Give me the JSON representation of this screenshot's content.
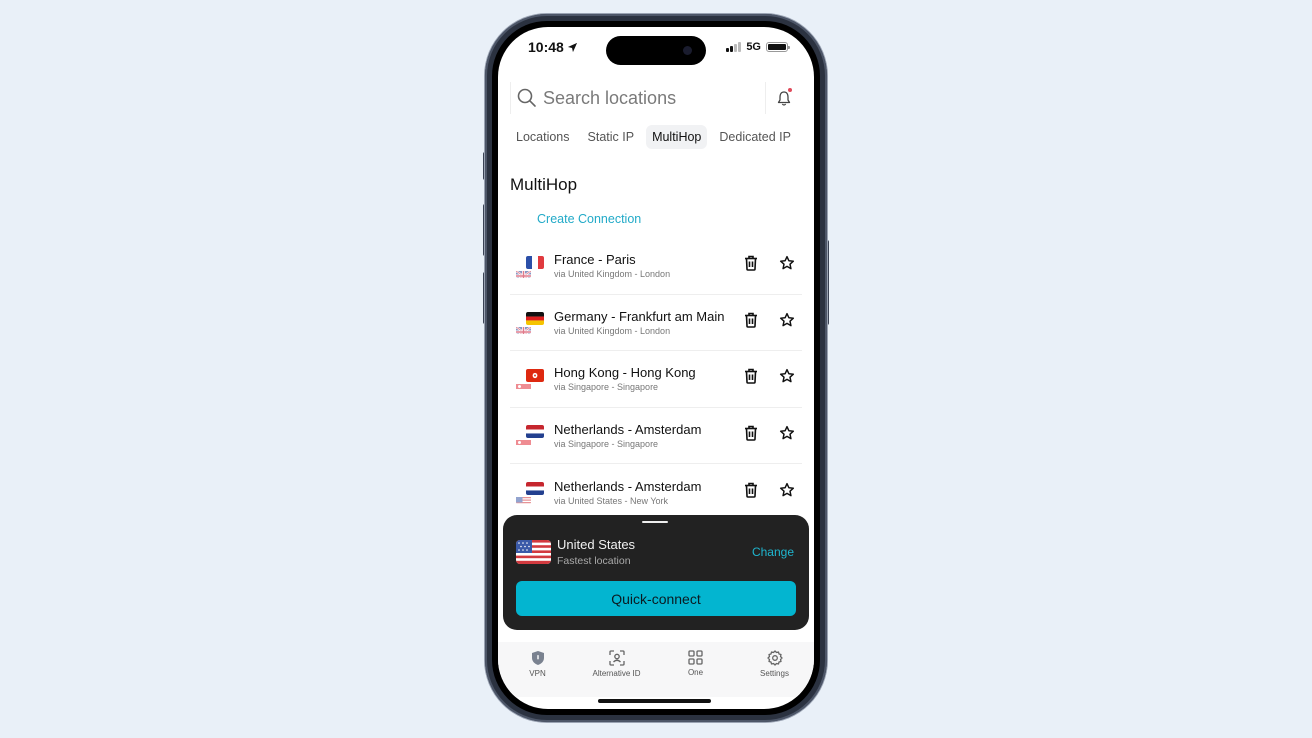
{
  "status_bar": {
    "time": "10:48",
    "network": "5G"
  },
  "search": {
    "placeholder": "Search locations",
    "value": ""
  },
  "tabs": [
    {
      "label": "Locations",
      "active": false
    },
    {
      "label": "Static IP",
      "active": false
    },
    {
      "label": "MultiHop",
      "active": true
    },
    {
      "label": "Dedicated IP",
      "active": false
    }
  ],
  "section": {
    "title": "MultiHop",
    "create_label": "Create Connection"
  },
  "connections": [
    {
      "title": "France - Paris",
      "via": "via United Kingdom - London",
      "dest_flag": "fr",
      "via_flag": "uk"
    },
    {
      "title": "Germany - Frankfurt am Main",
      "via": "via United Kingdom - London",
      "dest_flag": "de",
      "via_flag": "uk"
    },
    {
      "title": "Hong Kong - Hong Kong",
      "via": "via Singapore - Singapore",
      "dest_flag": "hk",
      "via_flag": "sg"
    },
    {
      "title": "Netherlands - Amsterdam",
      "via": "via Singapore - Singapore",
      "dest_flag": "nl",
      "via_flag": "sg"
    },
    {
      "title": "Netherlands - Amsterdam",
      "via": "via United States - New York",
      "dest_flag": "nl",
      "via_flag": "us"
    }
  ],
  "quick_connect": {
    "country": "United States",
    "subtitle": "Fastest location",
    "change_label": "Change",
    "button_label": "Quick-connect"
  },
  "bottom_nav": [
    {
      "label": "VPN",
      "icon": "shield-icon"
    },
    {
      "label": "Alternative ID",
      "icon": "face-scan-icon"
    },
    {
      "label": "One",
      "icon": "grid-icon"
    },
    {
      "label": "Settings",
      "icon": "gear-icon"
    }
  ],
  "colors": {
    "accent": "#03b5d0",
    "link": "#22aac8",
    "card_bg": "#222222",
    "notification_dot": "#e04a5a"
  }
}
